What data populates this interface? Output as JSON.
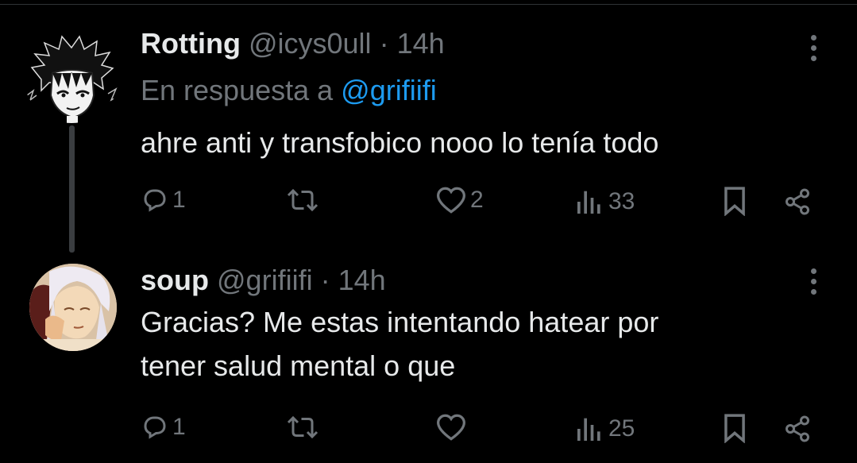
{
  "tweets": [
    {
      "name": "Rotting",
      "handle": "@icys0ull",
      "sep": "·",
      "time": "14h",
      "reply_prefix": "En respuesta a",
      "reply_to": "@grifiifi",
      "text": "ahre anti y transfobico nooo lo tenía todo",
      "replies": "1",
      "retweets": "",
      "likes": "2",
      "views": "33"
    },
    {
      "name": "soup",
      "handle": "@grifiifi",
      "sep": "·",
      "time": "14h",
      "text_line1": "Gracias? Me estas intentando hatear por",
      "text_line2": "tener salud mental o que",
      "replies": "1",
      "retweets": "",
      "likes": "",
      "views": "25"
    }
  ],
  "icons": {
    "reply": "reply-icon",
    "retweet": "retweet-icon",
    "like": "heart-icon",
    "views": "views-icon",
    "bookmark": "bookmark-icon",
    "share": "share-icon",
    "more": "more-icon"
  },
  "colors": {
    "background": "#000000",
    "text": "#e7e9ea",
    "muted": "#71767b",
    "link": "#1d9bf0"
  }
}
